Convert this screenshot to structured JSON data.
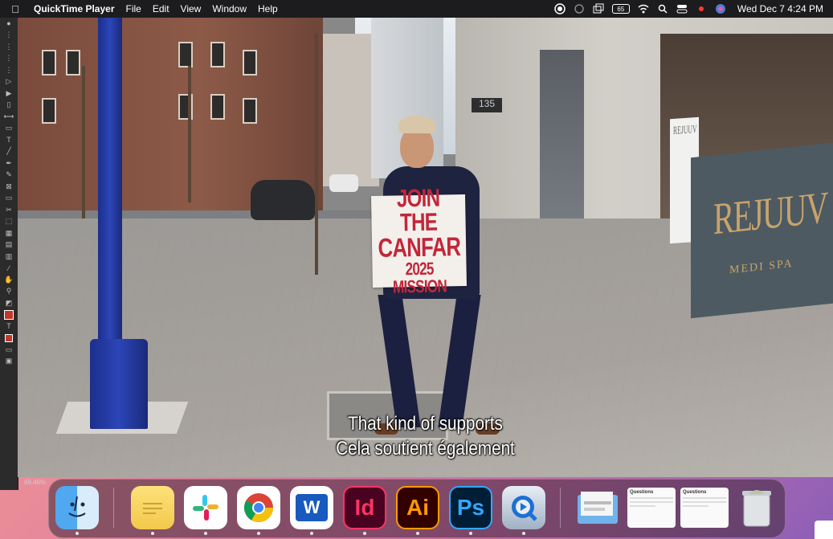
{
  "menubar": {
    "app_name": "QuickTime Player",
    "menus": [
      "File",
      "Edit",
      "View",
      "Window",
      "Help"
    ],
    "datetime": "Wed Dec 7  4:24 PM",
    "battery": "65"
  },
  "tools": {
    "zoom_level": "69.46%"
  },
  "video": {
    "subtitle_line1": "That kind of supports",
    "subtitle_line2": "Cela soutient également",
    "sign": {
      "line1": "JOIN THE",
      "line2": "CANFAR",
      "line3": "2025 MISSION"
    },
    "store_brand": "REJUUV",
    "store_sub": "MEDI SPA",
    "poster_text": "REJUUV",
    "address_number": "135"
  },
  "dock": {
    "apps": [
      {
        "name": "Finder",
        "icon": "finder-icon",
        "label": ""
      },
      {
        "name": "Stickies",
        "icon": "notes-icon",
        "label": ""
      },
      {
        "name": "Slack",
        "icon": "slack-icon",
        "label": ""
      },
      {
        "name": "Google Chrome",
        "icon": "chrome-icon",
        "label": ""
      },
      {
        "name": "Microsoft Word",
        "icon": "word-icon",
        "label": "W"
      },
      {
        "name": "Adobe InDesign",
        "icon": "indesign-icon",
        "label": "Id"
      },
      {
        "name": "Adobe Illustrator",
        "icon": "illustrator-icon",
        "label": "Ai"
      },
      {
        "name": "Adobe Photoshop",
        "icon": "photoshop-icon",
        "label": "Ps"
      },
      {
        "name": "QuickTime Player",
        "icon": "quicktime-icon",
        "label": ""
      }
    ],
    "docs": [
      {
        "title": "Questions"
      },
      {
        "title": "Questions"
      }
    ]
  },
  "colors": {
    "menubar_bg": "#1c1c1e",
    "sign_red": "#c3263a",
    "pole_blue": "#2c45b8"
  }
}
